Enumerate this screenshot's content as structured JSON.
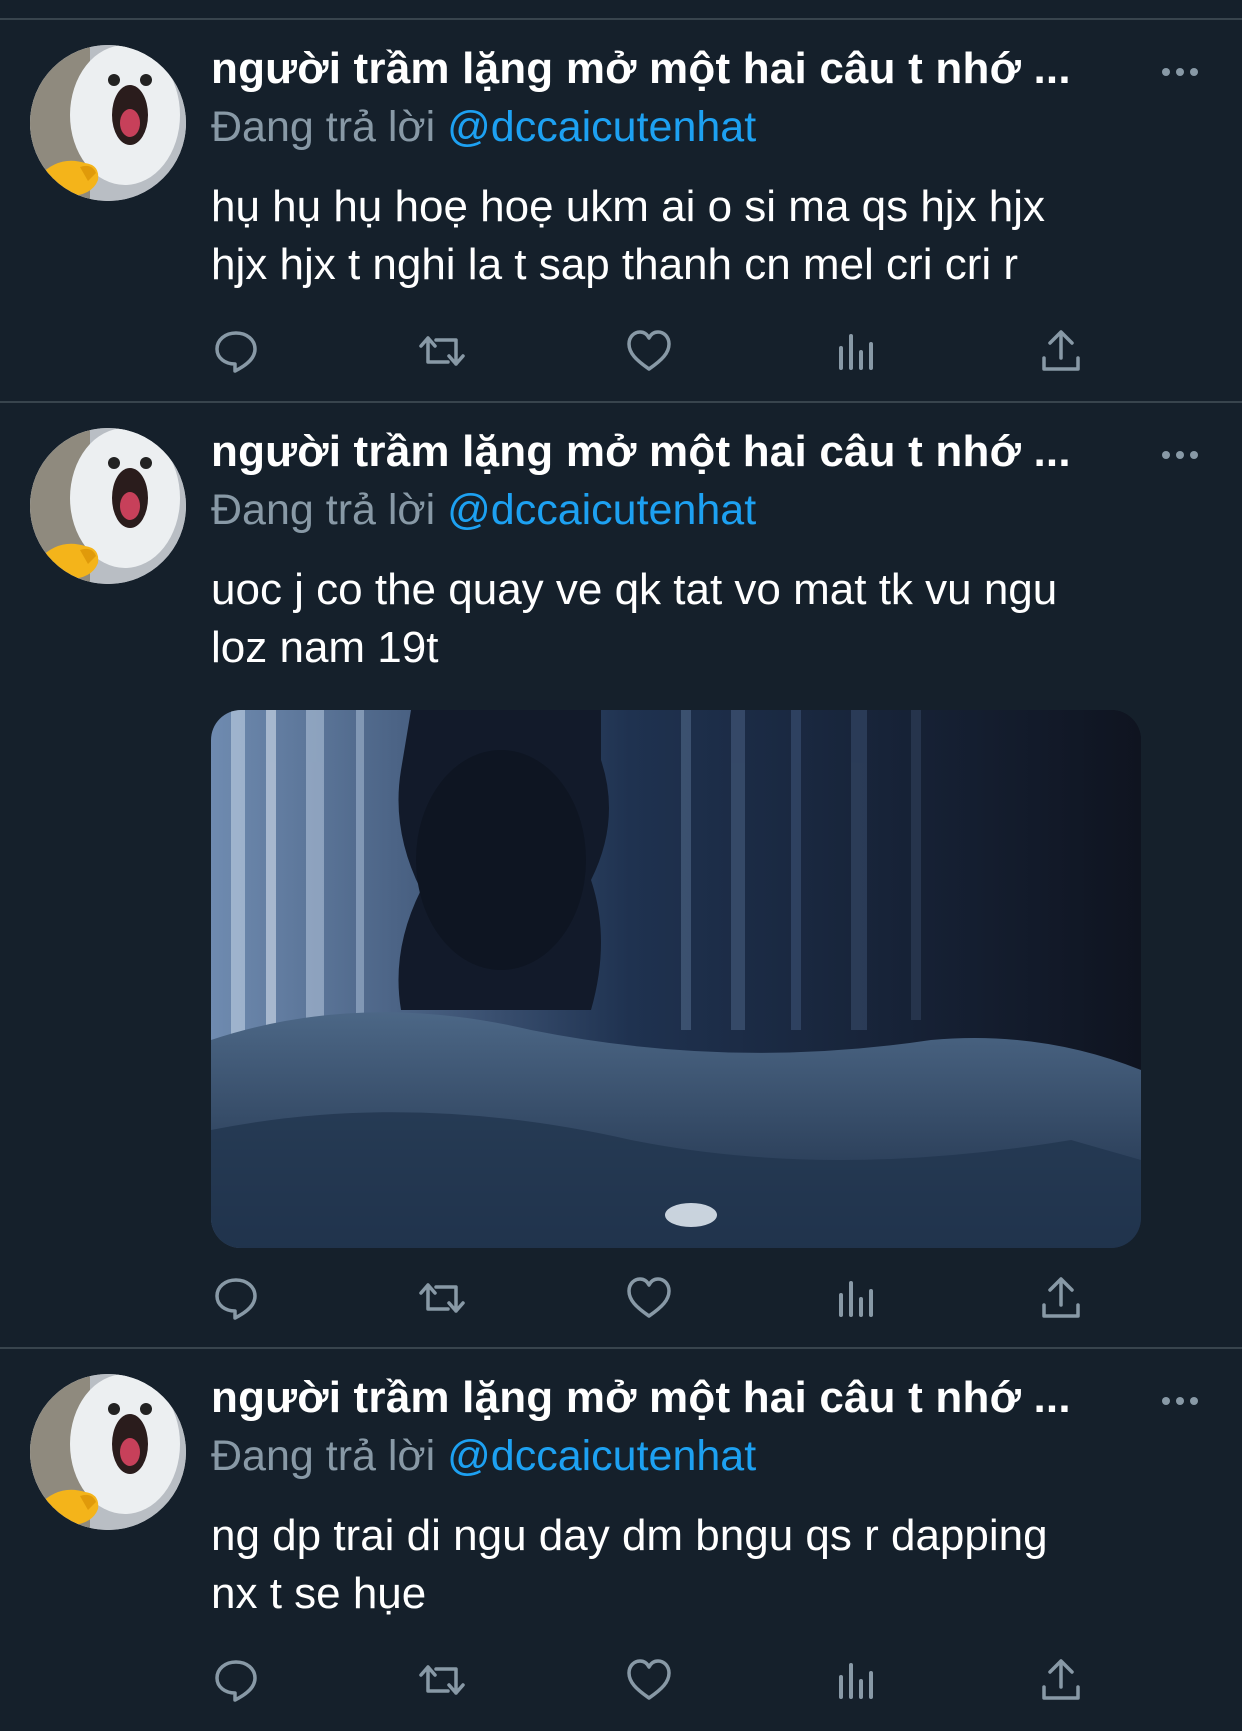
{
  "tweets": [
    {
      "display_name": "người trầm lặng mở một hai câu t nhớ ...",
      "reply_prefix": "Đang trả lời",
      "reply_handle": "@dccaicutenhat",
      "text_line1": "hụ hụ hụ hoẹ hoẹ ukm ai o si ma qs hjx hjx",
      "text_line2": "hjx hjx t nghi la t sap thanh cn mel cri cri r"
    },
    {
      "display_name": "người trầm lặng mở một hai câu t nhớ ...",
      "reply_prefix": "Đang trả lời",
      "reply_handle": "@dccaicutenhat",
      "text_line1": "uoc j co the quay ve qk tat vo mat tk vu ngu",
      "text_line2": "loz nam 19t",
      "media": "image"
    },
    {
      "display_name": "người trầm lặng mở một hai câu t nhớ ...",
      "reply_prefix": "Đang trả lời",
      "reply_handle": "@dccaicutenhat",
      "text_line1": "ng dp trai di ngu day dm bngu qs r dapping",
      "text_line2": "nx t se hụe"
    }
  ],
  "actions": [
    "reply-icon",
    "retweet-icon",
    "like-icon",
    "analytics-icon",
    "share-icon"
  ],
  "colors": {
    "background": "#15202b",
    "divider": "#38444d",
    "secondary_text": "#8899a6",
    "accent": "#1da1f2",
    "icon": "#8899a6"
  }
}
